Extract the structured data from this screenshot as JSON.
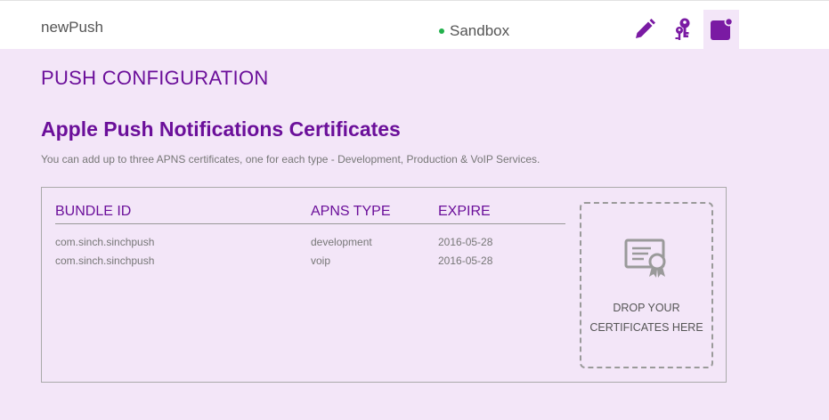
{
  "header": {
    "app_name": "newPush",
    "environment": "Sandbox",
    "environment_status_color": "#22b14c",
    "tools": [
      {
        "icon": "pencil-icon",
        "active": false
      },
      {
        "icon": "keys-icon",
        "active": false
      },
      {
        "icon": "notification-icon",
        "active": true
      }
    ]
  },
  "page": {
    "section_title": "PUSH CONFIGURATION",
    "subtitle": "Apple Push Notifications Certificates",
    "description": "You can add up to three APNS certificates, one for each type - Development, Production & VoIP Services."
  },
  "certificates": {
    "columns": [
      "BUNDLE ID",
      "APNS TYPE",
      "EXPIRE"
    ],
    "rows": [
      {
        "bundle_id": "com.sinch.sinchpush",
        "apns_type": "development",
        "expire": "2016-05-28"
      },
      {
        "bundle_id": "com.sinch.sinchpush",
        "apns_type": "voip",
        "expire": "2016-05-28"
      }
    ]
  },
  "dropzone": {
    "icon": "certificate-icon",
    "line1": "DROP YOUR",
    "line2": "CERTIFICATES HERE"
  },
  "colors": {
    "accent": "#6b0f9a",
    "background": "#f3e6f8"
  }
}
